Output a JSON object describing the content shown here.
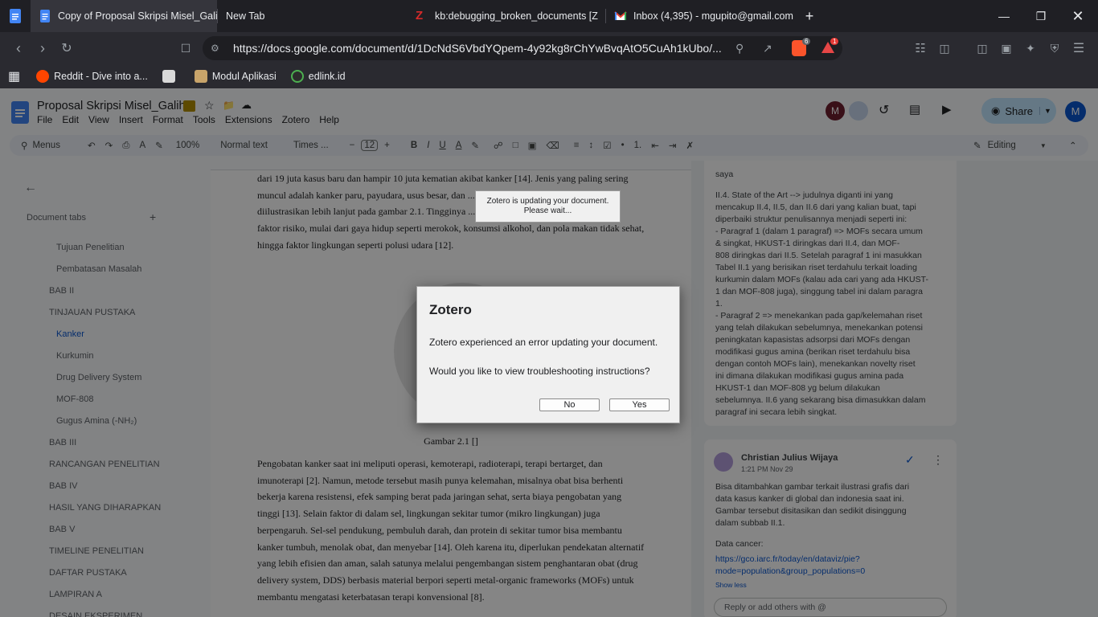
{
  "browser": {
    "tabs": [
      {
        "label": "Copy of Proposal Skripsi Misel_Galih",
        "icon": "docs-icon"
      },
      {
        "label": "New Tab",
        "icon": ""
      },
      {
        "label": "kb:debugging_broken_documents [Z",
        "icon": "zotero-icon"
      },
      {
        "label": "Inbox (4,395) - mgupito@gmail.com",
        "icon": "gmail-icon"
      }
    ],
    "url": "https://docs.google.com/document/d/1DcNdS6VbdYQpem-4y92kg8rChYwBvqAtO5CuAh1kUbo/...",
    "brave_badge": "6",
    "alert_badge": "1",
    "bookmarks": [
      {
        "label": "Reddit - Dive into a..."
      },
      {
        "label": ""
      },
      {
        "label": "Modul Aplikasi"
      },
      {
        "label": "edlink.id"
      }
    ]
  },
  "docs": {
    "title": "Proposal Skripsi Misel_Galih",
    "menu": [
      "File",
      "Edit",
      "View",
      "Insert",
      "Format",
      "Tools",
      "Extensions",
      "Zotero",
      "Help"
    ],
    "share_label": "Share",
    "avatar_letter": "M",
    "toolbar": {
      "menus": "Menus",
      "zoom": "100%",
      "style": "Normal text",
      "font": "Times ...",
      "font_size": "12",
      "mode": "Editing"
    }
  },
  "outline": {
    "header": "Document tabs",
    "items": [
      "Tujuan Penelitian",
      "Pembatasan Masalah",
      "BAB II",
      "TINJAUAN PUSTAKA",
      "Kanker",
      "Kurkumin",
      "Drug Delivery System",
      "MOF-808",
      "Gugus Amina (-NH₂)",
      "BAB III",
      "RANCANGAN PENELITIAN",
      "BAB IV",
      "HASIL YANG DIHARAPKAN",
      "BAB V",
      "TIMELINE PENELITIAN",
      "DAFTAR PUSTAKA",
      "LAMPIRAN A",
      "DESAIN EKSPERIMEN"
    ]
  },
  "page": {
    "top_lines": [
      "dari 19 juta kasus baru dan hampir 10 juta kematian akibat kanker [14]. Jenis yang paling sering",
      "muncul adalah kanker paru, payudara, usus besar, dan ... Data tersebut ... kanker ini",
      "diilustrasikan lebih lanjut pada gambar 2.1. Tingginya ... berbagai",
      "faktor risiko, mulai dari gaya hidup seperti merokok, konsumsi alkohol, dan pola makan tidak sehat,",
      "hingga faktor lingkungan seperti polusi udara [12]."
    ],
    "caption": "Gambar 2.1 []",
    "body": [
      "Pengobatan kanker saat ini meliputi operasi, kemoterapi, radioterapi, terapi bertarget, dan",
      "imunoterapi [2]. Namun, metode tersebut masih punya kelemahan, misalnya obat bisa berhenti",
      "bekerja karena resistensi, efek samping berat pada jaringan sehat, serta biaya pengobatan yang",
      "tinggi [13]. Selain faktor di dalam sel, lingkungan sekitar tumor (mikro lingkungan) juga",
      "berpengaruh. Sel-sel pendukung, pembuluh darah, dan protein di sekitar tumor bisa membantu",
      "kanker tumbuh, menolak obat, dan menyebar [14]. Oleh karena itu, diperlukan pendekatan alternatif",
      "yang lebih efisien dan aman, salah satunya melalui pengembangan sistem penghantaran obat (drug",
      "delivery system, DDS) berbasis material berpori seperti metal-organic frameworks (MOFs) untuk",
      "membantu mengatasi keterbatasan terapi konvensional [8]."
    ]
  },
  "comments": {
    "first": [
      "saya",
      "",
      "II.4. State of the Art --> judulnya diganti ini yang",
      "mencakup II.4, II.5, dan II.6 dari yang kalian buat, tapi",
      "diperbaiki struktur penulisannya menjadi seperti ini:",
      "- Paragraf 1 (dalam 1 paragraf) => MOFs secara umum",
      "& singkat, HKUST-1 diringkas dari II.4, dan MOF-",
      "808 diringkas dari II.5. Setelah paragraf 1 ini masukkan",
      "Tabel II.1 yang berisikan riset terdahulu terkait loading",
      "kurkumin dalam MOFs (kalau ada cari yang ada HKUST-",
      "1 dan MOF-808 juga), singgung tabel ini dalam paragra",
      "1.",
      "- Paragraf 2 => menekankan pada gap/kelemahan riset",
      "yang telah dilakukan sebelumnya, menekankan potensi",
      "peningkatan kapasistas adsorpsi dari MOFs dengan",
      "modifikasi gugus amina (berikan riset terdahulu bisa",
      "dengan contoh MOFs lain), menekankan novelty riset",
      "ini dimana dilakukan modifikasi gugus amina pada",
      "HKUST-1 dan MOF-808 yg belum dilakukan",
      "sebelumnya. II.6 yang sekarang bisa dimasukkan dalam",
      "paragraf ini secara lebih singkat."
    ],
    "second": {
      "author": "Christian Julius Wijaya",
      "time": "1:21 PM Nov 29",
      "lines": [
        "Bisa ditambahkan gambar terkait ilustrasi grafis dari",
        "data kasus kanker di global dan indonesia saat ini.",
        "Gambar tersebut disitasikan dan sedikit disinggung",
        "dalam subbab II.1.",
        "",
        "Data cancer:"
      ],
      "link1": "https://gco.iarc.fr/today/en/dataviz/pie?",
      "link2": "mode=population&group_populations=0",
      "show_less": "Show less",
      "reply_placeholder": "Reply or add others with @"
    }
  },
  "progress_tooltip": {
    "line1": "Zotero is updating your document.",
    "line2": "Please wait..."
  },
  "dialog": {
    "title": "Zotero",
    "message": "Zotero experienced an error updating your document.",
    "question": "Would you like to view troubleshooting instructions?",
    "no_label": "No",
    "yes_label": "Yes"
  },
  "colors": {
    "accent": "#0b57d0",
    "share_bg": "#c2e7ff"
  }
}
